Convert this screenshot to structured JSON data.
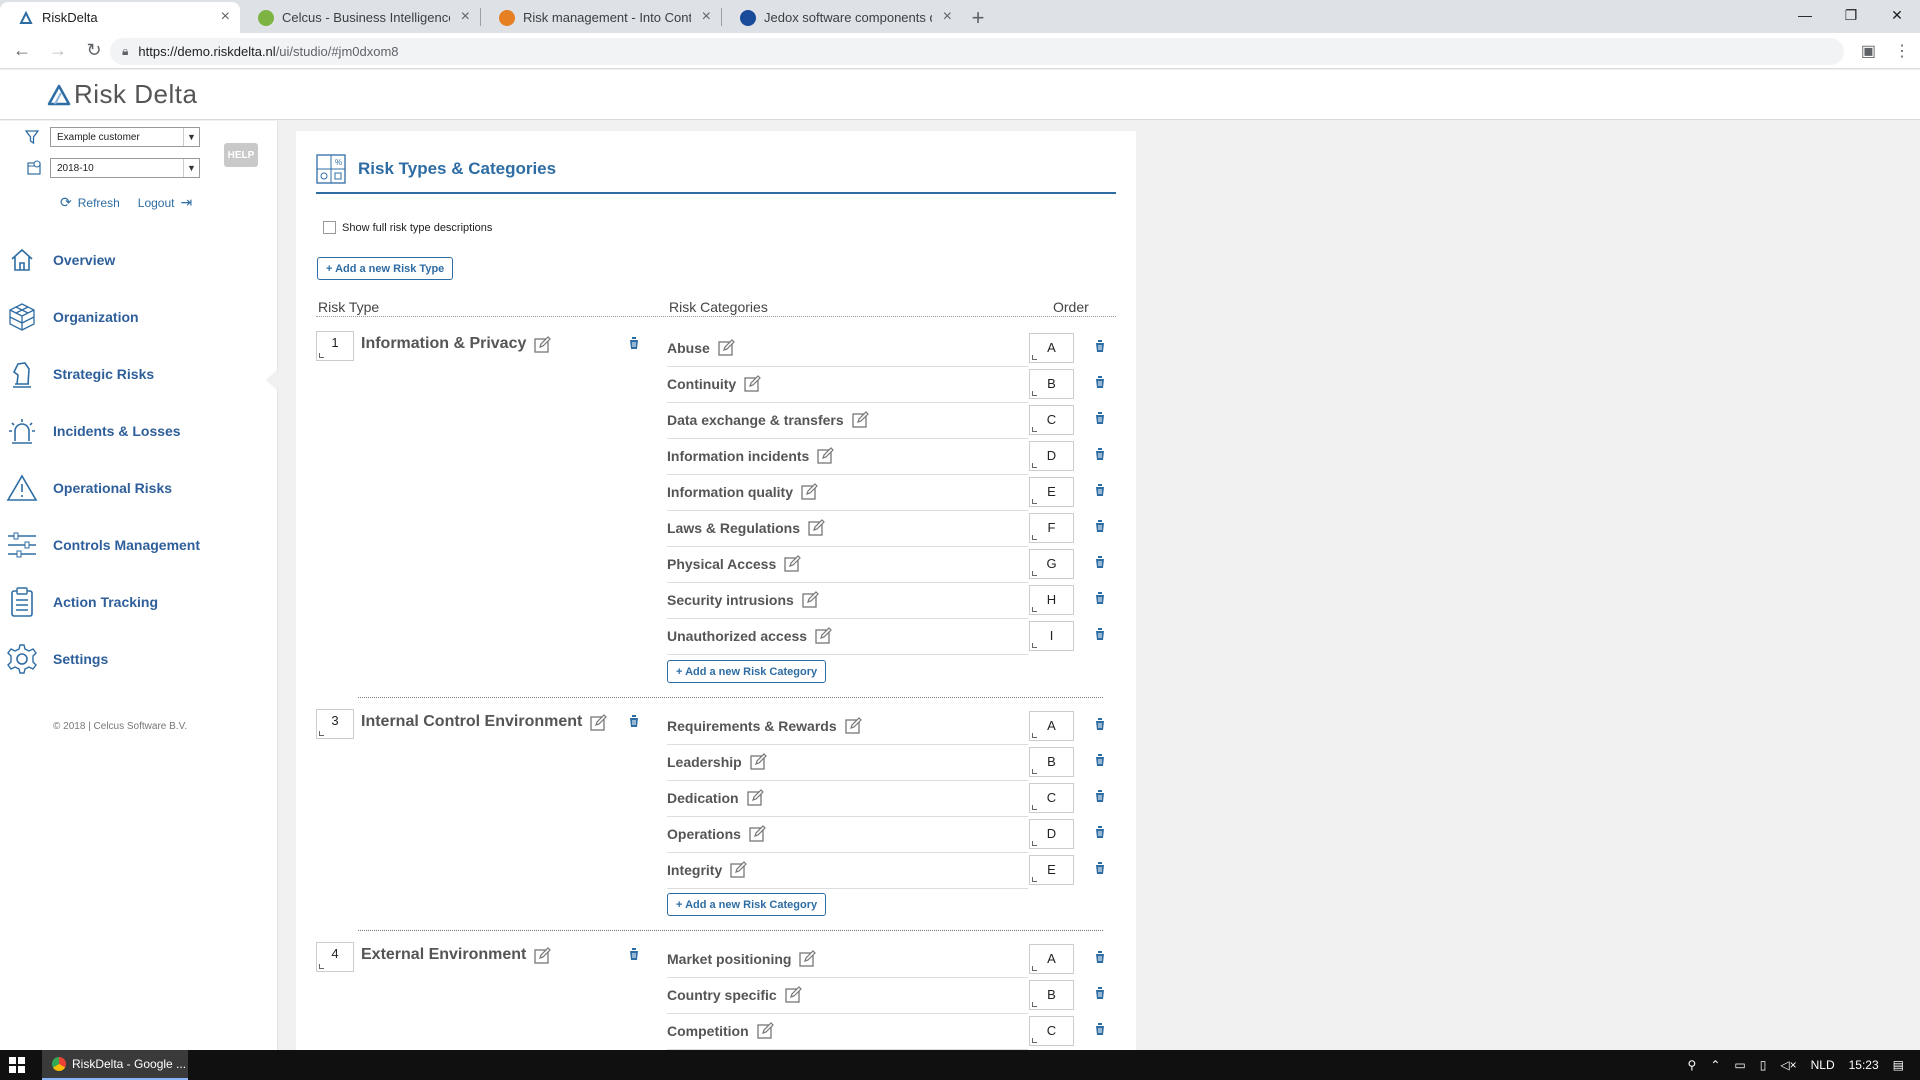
{
  "browser": {
    "tabs": [
      {
        "title": "RiskDelta",
        "active": true,
        "favicon_color": "#2e6da4"
      },
      {
        "title": "Celcus - Business Intelligence en",
        "active": false,
        "favicon_color": "#7cb342"
      },
      {
        "title": "Risk management - Into Control",
        "active": false,
        "favicon_color": "#e67e22"
      },
      {
        "title": "Jedox software components drive",
        "active": false,
        "favicon_color": "#1a4b9a"
      }
    ],
    "url_host": "https://demo.riskdelta.nl",
    "url_path": "/ui/studio/#jm0dxom8"
  },
  "app": {
    "logo_text": "Risk Delta",
    "filters": {
      "customer": "Example customer",
      "period": "2018-10"
    },
    "help_label": "HELP",
    "refresh_label": "Refresh",
    "logout_label": "Logout",
    "nav": [
      {
        "label": "Overview",
        "icon": "home-icon"
      },
      {
        "label": "Organization",
        "icon": "cube-icon"
      },
      {
        "label": "Strategic Risks",
        "icon": "chess-knight-icon"
      },
      {
        "label": "Incidents & Losses",
        "icon": "siren-icon"
      },
      {
        "label": "Operational Risks",
        "icon": "warning-icon"
      },
      {
        "label": "Controls Management",
        "icon": "sliders-icon"
      },
      {
        "label": "Action Tracking",
        "icon": "clipboard-icon"
      },
      {
        "label": "Settings",
        "icon": "gear-icon"
      }
    ],
    "copyright": "© 2018 | Celcus Software B.V."
  },
  "page": {
    "title": "Risk Types & Categories",
    "show_descriptions_label": "Show full risk type descriptions",
    "add_risk_type_label": "+ Add a new Risk Type",
    "add_category_label": "+ Add a new Risk Category",
    "col_risk_type": "Risk Type",
    "col_risk_categories": "Risk Categories",
    "col_order": "Order",
    "groups": [
      {
        "num": "1",
        "name": "Information & Privacy",
        "categories": [
          {
            "name": "Abuse",
            "order": "A"
          },
          {
            "name": "Continuity",
            "order": "B"
          },
          {
            "name": "Data exchange & transfers",
            "order": "C"
          },
          {
            "name": "Information incidents",
            "order": "D"
          },
          {
            "name": "Information quality",
            "order": "E"
          },
          {
            "name": "Laws & Regulations",
            "order": "F"
          },
          {
            "name": "Physical Access",
            "order": "G"
          },
          {
            "name": "Security intrusions",
            "order": "H"
          },
          {
            "name": "Unauthorized access",
            "order": "I"
          }
        ]
      },
      {
        "num": "3",
        "name": "Internal Control Environment",
        "categories": [
          {
            "name": "Requirements & Rewards",
            "order": "A"
          },
          {
            "name": "Leadership",
            "order": "B"
          },
          {
            "name": "Dedication",
            "order": "C"
          },
          {
            "name": "Operations",
            "order": "D"
          },
          {
            "name": "Integrity",
            "order": "E"
          }
        ]
      },
      {
        "num": "4",
        "name": "External Environment",
        "categories": [
          {
            "name": "Market positioning",
            "order": "A"
          },
          {
            "name": "Country specific",
            "order": "B"
          },
          {
            "name": "Competition",
            "order": "C"
          }
        ]
      }
    ]
  },
  "taskbar": {
    "app_label": "RiskDelta - Google ...",
    "lang": "NLD",
    "time": "15:23"
  },
  "colors": {
    "accent": "#2e6da4",
    "nav_text": "#2e5f9a"
  }
}
